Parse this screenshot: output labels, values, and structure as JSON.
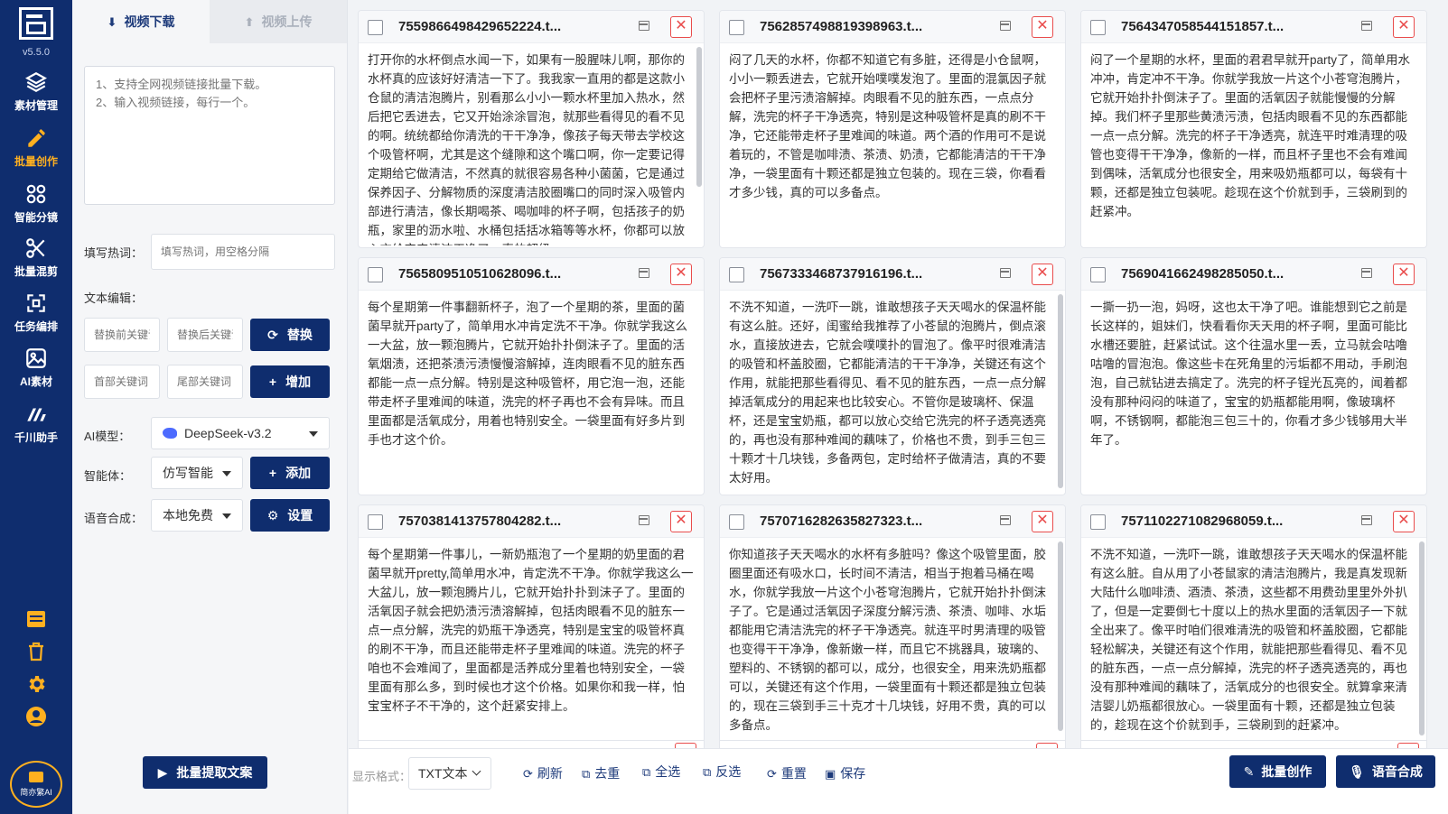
{
  "app": {
    "version": "v5.5.0",
    "brand_label": "简亦繁AI"
  },
  "nav": [
    {
      "label": "素材管理",
      "icon": "layers-icon"
    },
    {
      "label": "批量创作",
      "icon": "pencil-icon"
    },
    {
      "label": "智能分镜",
      "icon": "film-split-icon"
    },
    {
      "label": "批量混剪",
      "icon": "scissors-icon"
    },
    {
      "label": "任务编排",
      "icon": "arrange-icon"
    },
    {
      "label": "AI素材",
      "icon": "image-icon"
    },
    {
      "label": "千川助手",
      "icon": "qianchuan-icon"
    }
  ],
  "panel": {
    "tabs": [
      {
        "label": "视频下载",
        "icon": "download-icon"
      },
      {
        "label": "视频上传",
        "icon": "upload-icon"
      }
    ],
    "url_placeholder": "1、支持全网视频链接批量下载。\n2、输入视频链接，每行一个。",
    "hotwords_label": "填写热词：",
    "hotwords_placeholder": "填写热词，用空格分隔",
    "text_edit_label": "文本编辑：",
    "replace_before_placeholder": "替换前关键词",
    "replace_after_placeholder": "替换后关键词",
    "replace_button": "替换",
    "head_keyword_placeholder": "首部关键词",
    "tail_keyword_placeholder": "尾部关键词",
    "add_keyword_button": "增加",
    "ai_model_label": "AI模型：",
    "ai_model_value": "DeepSeek-v3.2",
    "agent_label": "智能体：",
    "agent_value": "仿写智能",
    "agent_add_button": "添加",
    "tts_label": "语音合成：",
    "tts_value": "本地免费",
    "tts_settings_button": "设置",
    "extract_button": "批量提取文案"
  },
  "cards": [
    {
      "title": "7559866498429652224.t...",
      "text": "打开你的水杯倒点水闻一下，如果有一股腥味儿啊，那你的水杯真的应该好好清洁一下了。我我家一直用的都是这款小仓鼠的清洁泡腾片，别看那么小小一颗水杯里加入热水，然后把它丢进去，它又开始涂涂冒泡，就那些看得见的看不见的啊。统统都给你清洗的干干净净，像孩子每天带去学校这个吸管杯啊，尤其是这个缝隙和这个嘴口啊，你一定要记得定期给它做清洁，不然真的就很容易各种小菌菌，它是通过保养因子、分解物质的深度清洁胶圈嘴口的同时深入吸管内部进行清洁，像长期喝茶、喝咖啡的杯子啊，包括孩子的奶瓶，家里的沥水啦、水桶包括括冰箱等等水杯，你都可以放心交给它来清洁干净了，真的超级"
    },
    {
      "title": "7562857498819398963.t...",
      "text": "闷了几天的水杯，你都不知道它有多脏，还得是小仓鼠啊，小小一颗丢进去，它就开始噗噗发泡了。里面的混氯因子就会把杯子里污渍溶解掉。肉眼看不见的脏东西，一点点分解，洗完的杯子干净透亮，特别是这种吸管杯是真的刷不干净，它还能带走杯子里难闻的味道。两个酒的作用可不是说着玩的，不管是咖啡渍、茶渍、奶渍，它都能清洁的干干净净，一袋里面有十颗还都是独立包装的。现在三袋，你看看才多少钱，真的可以多备点。"
    },
    {
      "title": "7564347058544151857.t...",
      "text": "闷了一个星期的水杯，里面的君君早就开party了，简单用水冲冲，肯定冲不干净。你就学我放一片这个小苍穹泡腾片，它就开始扑扑倒沫子了。里面的活氧因子就能慢慢的分解掉。我们杯子里那些黄渍污渍，包括肉眼看不见的东西都能一点一点分解。洗完的杯子干净透亮，就连平时难清理的吸管也变得干干净净，像新的一样，而且杯子里也不会有难闻到偶味，活氧成分也很安全，用来吸奶瓶都可以，每袋有十颗，还都是独立包装呢。趁现在这个价就到手，三袋刷到的赶紧冲。"
    },
    {
      "title": "7565809510510628096.t...",
      "text": "每个星期第一件事翻新杯子，泡了一个星期的茶，里面的菌菌早就开party了，简单用水冲肯定洗不干净。你就学我这么一大盆，放一颗泡腾片，它就开始扑扑倒沫子了。里面的活氧烟渍，还把茶渍污渍慢慢溶解掉，连肉眼看不见的脏东西都能一点一点分解。特别是这种吸管杯，用它泡一泡，还能带走杯子里难闻的味道，洗完的杯子再也不会有异味。而且里面都是活氧成分，用着也特别安全。一袋里面有好多片到手也才这个价。"
    },
    {
      "title": "7567333468737916196.t...",
      "text": "不洗不知道，一洗吓一跳，谁敢想孩子天天喝水的保温杯能有这么脏。还好，闺蜜给我推荐了小苍鼠的泡腾片，倒点滚水，直接放进去，它就会噗噗扑的冒泡了。像平时很难清洁的吸管和杯盖胶圈，它都能清洁的干干净净，关键还有这个作用，就能把那些看得见、看不见的脏东西，一点一点分解掉活氧成分的用起来也比较安心。不管你是玻璃杯、保温杯，还是宝宝奶瓶，都可以放心交给它洗完的杯子透亮透亮的，再也没有那种难闻的藕味了，价格也不贵，到手三包三十颗才十几块钱，多备两包，定时给杯子做清洁，真的不要太好用。"
    },
    {
      "title": "7569041662498285050.t...",
      "text": "一撕一扔一泡，妈呀，这也太干净了吧。谁能想到它之前是长这样的，姐妹们，快看看你天天用的杯子啊，里面可能比水槽还要脏，赶紧试试。这个往温水里一丢，立马就会咕噜咕噜的冒泡泡。像这些卡在死角里的污垢都不用动，手刷泡泡，自己就钻进去搞定了。洗完的杯子锃光瓦亮的，闻着都没有那种闷闷的味道了，宝宝的奶瓶都能用啊，像玻璃杯啊，不锈钢啊，都能泡三包三十的，你看才多少钱够用大半年了。"
    },
    {
      "title": "7570381413757804282.t...",
      "text": "每个星期第一件事儿，一新奶瓶泡了一个星期的奶里面的君菌早就开pretty,简单用水冲，肯定洗不干净。你就学我这么一大盆儿，放一颗泡腾片儿，它就开始扑扑到沫子了。里面的活氧因子就会把奶渍污渍溶解掉，包括肉眼看不见的脏东一点一点分解，洗完的奶瓶干净透亮，特别是宝宝的吸管杯真的刷不干净，而且还能带走杯子里难闻的味道。洗完的杯子咱也不会难闻了，里面都是活养成分里着也特别安全，一袋里面有那么多，到时候也才这个价格。如果你和我一样，怕宝宝杯子不干净的，这个赶紧安排上。"
    },
    {
      "title": "7570716282635827323.t...",
      "text": "你知道孩子天天喝水的水杯有多脏吗？像这个吸管里面，胶圈里面还有吸水口，长时间不清洁，相当于抱着马桶在喝水，你就学我放一片这个小苍穹泡腾片，它就开始扑扑倒沫子了。它是通过活氧因子深度分解污渍、茶渍、咖啡、水垢都能用它清洁洗完的杯子干净透亮。就连平时男清理的吸管也变得干干净净，像新嫩一样，而且它不挑器具，玻璃的、塑料的、不锈钢的都可以，成分，也很安全，用来洗奶瓶都可以，关键还有这个作用，一袋里面有十颗还都是独立包装的，现在三袋到手三十克才十几块钱，好用不贵，真的可以多备点。"
    },
    {
      "title": "7571102271082968059.t...",
      "text": "不洗不知道，一洗吓一跳，谁敢想孩子天天喝水的保温杯能有这么脏。自从用了小苍鼠家的清洁泡腾片，我是真发现新大陆什么咖啡渍、酒渍、茶渍，这些都不用费劲里里外外扒了，但是一定要倒七十度以上的热水里面的活氧因子一下就全出来了。像平时咱们很难清洗的吸管和杯盖胶圈，它都能轻松解决，关键还有这个作用，就能把那些看得见、看不见的脏东西，一点一点分解掉，洗完的杯子透亮透亮的，再也没有那种难闻的藕味了，活氧成分的也很安全。就算拿来清洁婴儿奶瓶都很放心。一袋里面有十颗，还都是独立包装的，趁现在这个价就到手，三袋刷到的赶紧冲。"
    }
  ],
  "toolbar": {
    "format_label": "显示格式：",
    "format_value": "TXT文本",
    "refresh": "刷新",
    "dedupe": "去重",
    "select_all": "全选",
    "invert": "反选",
    "reset": "重置",
    "save": "保存",
    "batch_create": "批量创作",
    "tts": "语音合成"
  },
  "colors": {
    "sidebar": "#0f2d6e",
    "active_nav": "#ffb020",
    "danger": "#e94c4c",
    "primary_button": "#0f2d6e"
  }
}
